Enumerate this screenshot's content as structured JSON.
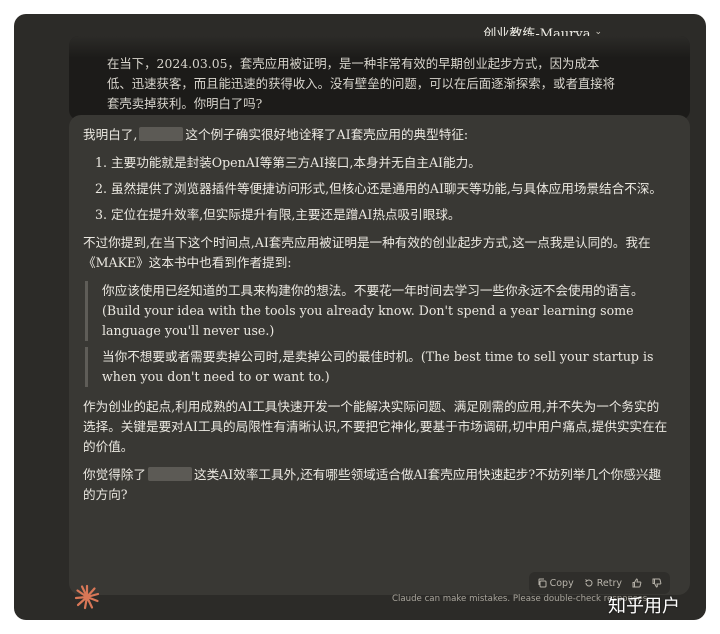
{
  "header": {
    "project_title": "创业教练-Maurya"
  },
  "user_message": {
    "line1": "在当下，2024.03.05，套壳应用被证明，是一种非常有效的早期创业起步方式，因为成本",
    "line2": "低、迅速获客，而且能迅速的获得收入。没有壁垒的问题，可以在后面逐渐探索，或者直接将",
    "line3": "套壳卖掉获利。你明白了吗?"
  },
  "assistant": {
    "intro_before": "我明白了,",
    "intro_after": "这个例子确实很好地诠释了AI套壳应用的典型特征:",
    "list": [
      {
        "num": "1.",
        "text": "主要功能就是封装OpenAI等第三方AI接口,本身并无自主AI能力。"
      },
      {
        "num": "2.",
        "text": "虽然提供了浏览器插件等便捷访问形式,但核心还是通用的AI聊天等功能,与具体应用场景结合不深。"
      },
      {
        "num": "3.",
        "text": "定位在提升效率,但实际提升有限,主要还是蹭AI热点吸引眼球。"
      }
    ],
    "para2": "不过你提到,在当下这个时间点,AI套壳应用被证明是一种有效的创业起步方式,这一点我是认同的。我在《MAKE》这本书中也看到作者提到:",
    "quote1": "你应该使用已经知道的工具来构建你的想法。不要花一年时间去学习一些你永远不会使用的语言。(Build your idea with the tools you already know. Don't spend a year learning some language you'll never use.)",
    "quote2": "当你不想要或者需要卖掉公司时,是卖掉公司的最佳时机。(The best time to sell your startup is when you don't need to or want to.)",
    "para3": "作为创业的起点,利用成熟的AI工具快速开发一个能解决实际问题、满足刚需的应用,并不失为一个务实的选择。关键是要对AI工具的局限性有清晰认识,不要把它神化,要基于市场调研,切中用户痛点,提供实实在在的价值。",
    "para4_before": "你觉得除了",
    "para4_after": "这类AI效率工具外,还有哪些领域适合做AI套壳应用快速起步?不妨列举几个你感兴趣的方向?"
  },
  "actions": {
    "copy_label": "Copy",
    "retry_label": "Retry"
  },
  "footer": {
    "disclaimer": "Claude can make mistakes. Please double-check responses."
  },
  "watermark": "知乎用户",
  "colors": {
    "background": "#2c2b28",
    "assistant_bubble": "#393834",
    "user_bubble": "#1c1b19",
    "logo_accent": "#d97757"
  }
}
